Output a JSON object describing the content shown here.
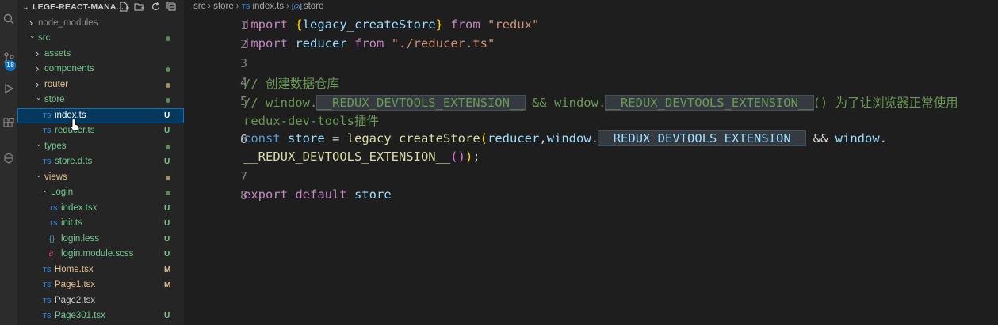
{
  "activity_bar": {
    "source_control_badge": "18",
    "icons": [
      "search-icon",
      "source-control-icon",
      "run-debug-icon",
      "extensions-icon",
      "remote-icon"
    ]
  },
  "explorer": {
    "project_title": "LEGE-REACT-MANA...",
    "actions": [
      "new-file-icon",
      "new-folder-icon",
      "refresh-icon",
      "collapse-all-icon"
    ],
    "tree": [
      {
        "label": "node_modules",
        "kind": "folder",
        "expanded": false,
        "depth": 0,
        "status": "",
        "color": "#8c8c8c",
        "dot": ""
      },
      {
        "label": "src",
        "kind": "folder",
        "expanded": true,
        "depth": 0,
        "status": "",
        "color": "#73c991",
        "dot": "#5a8c5a"
      },
      {
        "label": "assets",
        "kind": "folder",
        "expanded": false,
        "depth": 1,
        "status": "",
        "color": "#73c991",
        "dot": ""
      },
      {
        "label": "components",
        "kind": "folder",
        "expanded": false,
        "depth": 1,
        "status": "",
        "color": "#73c991",
        "dot": "#5a8c5a"
      },
      {
        "label": "router",
        "kind": "folder",
        "expanded": false,
        "depth": 1,
        "status": "",
        "color": "#e2c08d",
        "dot": "#a58f64"
      },
      {
        "label": "store",
        "kind": "folder",
        "expanded": true,
        "depth": 1,
        "status": "",
        "color": "#73c991",
        "dot": "#5a8c5a"
      },
      {
        "label": "index.ts",
        "kind": "ts",
        "depth": 2,
        "status": "U",
        "color": "#ffffff",
        "selected": true
      },
      {
        "label": "reducer.ts",
        "kind": "ts",
        "depth": 2,
        "status": "U",
        "color": "#73c991"
      },
      {
        "label": "types",
        "kind": "folder",
        "expanded": true,
        "depth": 1,
        "status": "",
        "color": "#73c991",
        "dot": "#5a8c5a"
      },
      {
        "label": "store.d.ts",
        "kind": "ts",
        "depth": 2,
        "status": "U",
        "color": "#73c991"
      },
      {
        "label": "views",
        "kind": "folder",
        "expanded": true,
        "depth": 1,
        "status": "",
        "color": "#e2c08d",
        "dot": "#a58f64"
      },
      {
        "label": "Login",
        "kind": "folder",
        "expanded": true,
        "depth": 2,
        "status": "",
        "color": "#73c991",
        "dot": "#5a8c5a"
      },
      {
        "label": "index.tsx",
        "kind": "ts",
        "depth": 3,
        "status": "U",
        "color": "#73c991"
      },
      {
        "label": "init.ts",
        "kind": "ts",
        "depth": 3,
        "status": "U",
        "color": "#73c991"
      },
      {
        "label": "login.less",
        "kind": "less",
        "depth": 3,
        "status": "U",
        "color": "#73c991"
      },
      {
        "label": "login.module.scss",
        "kind": "scss",
        "depth": 3,
        "status": "U",
        "color": "#73c991"
      },
      {
        "label": "Home.tsx",
        "kind": "ts",
        "depth": 2,
        "status": "M",
        "color": "#e2c08d"
      },
      {
        "label": "Page1.tsx",
        "kind": "ts",
        "depth": 2,
        "status": "M",
        "color": "#e2c08d"
      },
      {
        "label": "Page2.tsx",
        "kind": "ts",
        "depth": 2,
        "status": "",
        "color": "#cccccc"
      },
      {
        "label": "Page301.tsx",
        "kind": "ts",
        "depth": 2,
        "status": "U",
        "color": "#73c991"
      }
    ]
  },
  "editor": {
    "breadcrumb": [
      "src",
      "store",
      "index.ts",
      "store"
    ],
    "active_line": "6",
    "lines": [
      {
        "num": "1",
        "tokens": [
          [
            "kw",
            "import"
          ],
          [
            "plain",
            " "
          ],
          [
            "brace",
            "{"
          ],
          [
            "var",
            "legacy_createStore"
          ],
          [
            "brace",
            "}"
          ],
          [
            "plain",
            " "
          ],
          [
            "kw",
            "from"
          ],
          [
            "plain",
            " "
          ],
          [
            "str",
            "\"redux\""
          ]
        ]
      },
      {
        "num": "2",
        "tokens": [
          [
            "kw",
            "import"
          ],
          [
            "plain",
            " "
          ],
          [
            "var",
            "reducer"
          ],
          [
            "plain",
            " "
          ],
          [
            "kw",
            "from"
          ],
          [
            "plain",
            " "
          ],
          [
            "str",
            "\"./reducer.ts\""
          ]
        ]
      },
      {
        "num": "3",
        "tokens": []
      },
      {
        "num": "4",
        "tokens": [
          [
            "cm",
            "// 创建数据仓库"
          ]
        ]
      },
      {
        "num": "5",
        "tokens": [
          [
            "cm",
            "// window."
          ],
          [
            "cmhl",
            "__REDUX_DEVTOOLS_EXTENSION__"
          ],
          [
            "cm",
            " && window."
          ],
          [
            "cmhl",
            "__REDUX_DEVTOOLS_EXTENSION__"
          ],
          [
            "cm",
            "() 为了让浏览器正常使用"
          ]
        ]
      },
      {
        "num": "",
        "tokens": [
          [
            "cm",
            "redux-dev-tools插件"
          ]
        ]
      },
      {
        "num": "6",
        "tokens": [
          [
            "kw2",
            "const"
          ],
          [
            "plain",
            " "
          ],
          [
            "var",
            "store"
          ],
          [
            "plain",
            " = "
          ],
          [
            "fn",
            "legacy_createStore"
          ],
          [
            "brace",
            "("
          ],
          [
            "var",
            "reducer"
          ],
          [
            "plain",
            ","
          ],
          [
            "var",
            "window"
          ],
          [
            "plain",
            "."
          ],
          [
            "varhl",
            "__REDUX_DEVTOOLS_EXTENSION__"
          ],
          [
            "plain",
            " && "
          ],
          [
            "var",
            "window"
          ],
          [
            "plain",
            "."
          ]
        ]
      },
      {
        "num": "",
        "tokens": [
          [
            "fn",
            "__REDUX_DEVTOOLS_EXTENSION__"
          ],
          [
            "paren",
            "()"
          ],
          [
            "brace",
            ")"
          ],
          [
            "plain",
            ";"
          ]
        ]
      },
      {
        "num": "7",
        "tokens": []
      },
      {
        "num": "8",
        "tokens": [
          [
            "kw",
            "export"
          ],
          [
            "plain",
            " "
          ],
          [
            "kw",
            "default"
          ],
          [
            "plain",
            " "
          ],
          [
            "var",
            "store"
          ]
        ]
      }
    ]
  }
}
